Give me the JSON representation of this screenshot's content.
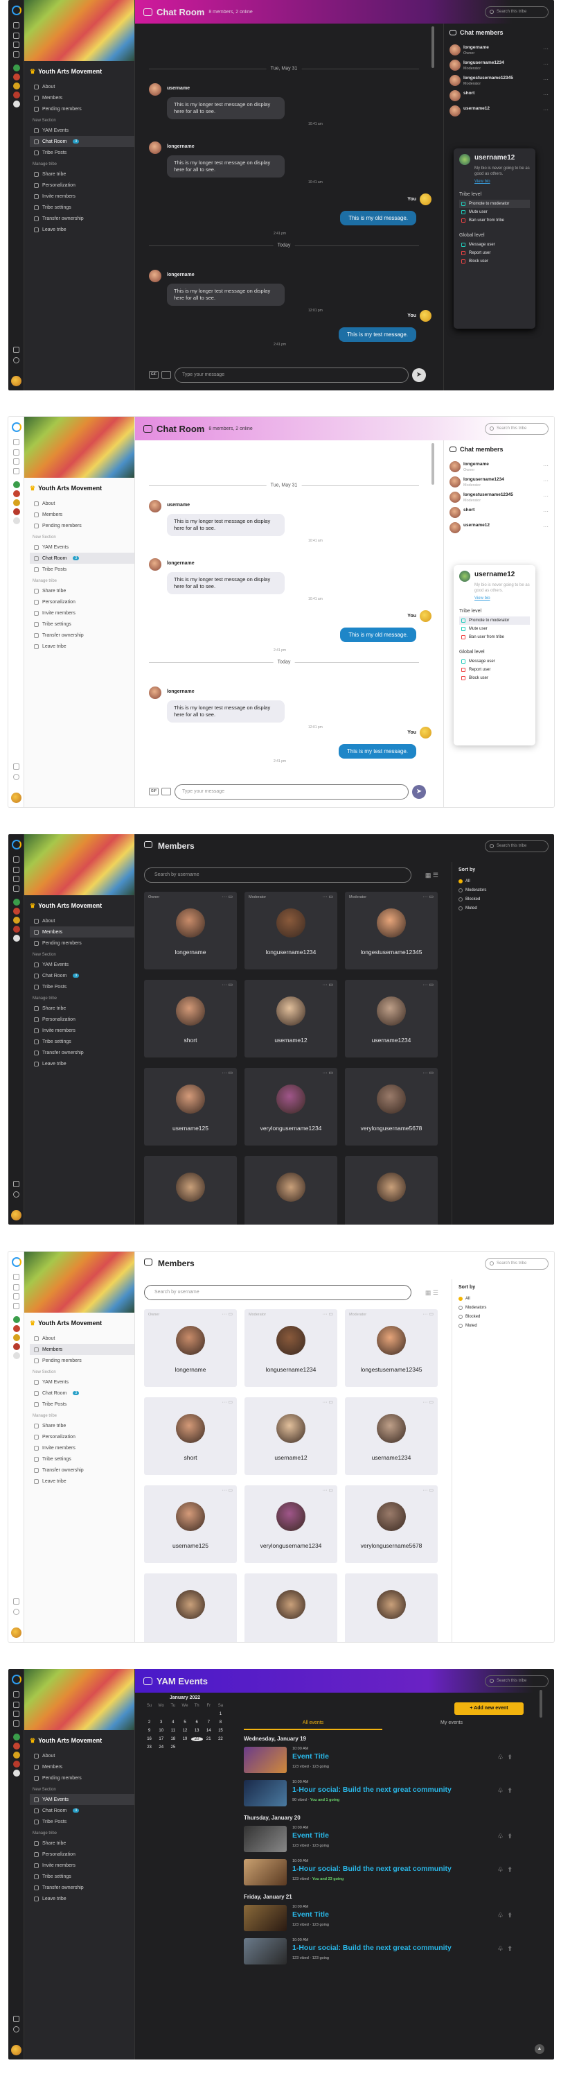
{
  "tribe": {
    "name": "Youth Arts Movement",
    "nav_main": [
      "About",
      "Members",
      "Pending members"
    ],
    "new_section_label": "New Section",
    "nav_new": [
      "YAM Events",
      "Chat Room",
      "Tribe Posts"
    ],
    "chat_badge": "3",
    "manage_label": "Manage tribe",
    "nav_manage": [
      "Share tribe",
      "Personalization",
      "Invite members",
      "Tribe settings",
      "Transfer ownership",
      "Leave tribe"
    ]
  },
  "search_placeholder": "Search this tribe",
  "chat": {
    "title": "Chat Room",
    "subtitle": "8 members, 2 online",
    "date1": "Tue, May 31",
    "date2": "Today",
    "msg_user1": "username",
    "msg_user2": "longername",
    "long_text": "This is my longer test message on display here for all to see.",
    "t1": "10:41 am",
    "t2": "12:01 pm",
    "t3": "2:41 pm",
    "mine_old": "This is my old message.",
    "mine_test": "This is my test message.",
    "you": "You",
    "composer_placeholder": "Type your message",
    "gif_label": "GIF"
  },
  "chat_members": {
    "title": "Chat members",
    "list": [
      {
        "name": "longername",
        "role": "Owner"
      },
      {
        "name": "longusername1234",
        "role": "Moderator"
      },
      {
        "name": "longestusername12345",
        "role": "Moderator"
      },
      {
        "name": "short",
        "role": ""
      },
      {
        "name": "username12",
        "role": ""
      }
    ]
  },
  "popover": {
    "name": "username12",
    "bio": "My bio is never going to be as good as others.",
    "view_bio": "View bio",
    "tribe_level": "Tribe level",
    "tribe_actions": [
      "Promote to moderator",
      "Mute user",
      "Ban user from tribe"
    ],
    "global_level": "Global level",
    "global_actions": [
      "Message user",
      "Report user",
      "Block user"
    ]
  },
  "members_page": {
    "title": "Members",
    "search_placeholder": "Search by username",
    "sort_title": "Sort by",
    "sort_options": [
      "All",
      "Moderators",
      "Blocked",
      "Muted"
    ],
    "role_owner": "Owner",
    "role_mod": "Moderator",
    "cards": [
      "longername",
      "longusername1234",
      "longestusername12345",
      "short",
      "username12",
      "username1234",
      "username125",
      "verylongusername1234",
      "verylongusername5678"
    ]
  },
  "events": {
    "title": "YAM Events",
    "add_button": "+ Add new event",
    "tab_all": "All events",
    "tab_my": "My events",
    "calendar_title": "January 2022",
    "weekdays": [
      "Su",
      "Mo",
      "Tu",
      "We",
      "Th",
      "Fr",
      "Sa"
    ],
    "days": [
      {
        "heading": "Wednesday, January 19",
        "items": [
          {
            "time": "10:00 AM",
            "title": "Event Title",
            "meta": "123 vibed · 123 going",
            "going": ""
          },
          {
            "time": "10:00 AM",
            "title": "1-Hour social: Build the next great community",
            "meta": "90 vibed ·",
            "going": "You and 1 going"
          }
        ]
      },
      {
        "heading": "Thursday, January 20",
        "items": [
          {
            "time": "10:00 AM",
            "title": "Event Title",
            "meta": "123 vibed · 123 going",
            "going": ""
          },
          {
            "time": "10:00 AM",
            "title": "1-Hour social: Build the next great community",
            "meta": "123 vibed ·",
            "going": "You and 23 going"
          }
        ]
      },
      {
        "heading": "Friday, January 21",
        "items": [
          {
            "time": "10:00 AM",
            "title": "Event Title",
            "meta": "123 vibed · 123 going",
            "going": ""
          },
          {
            "time": "10:00 AM",
            "title": "1-Hour social: Build the next great community",
            "meta": "123 vibed · 123 going",
            "going": ""
          }
        ]
      }
    ]
  }
}
